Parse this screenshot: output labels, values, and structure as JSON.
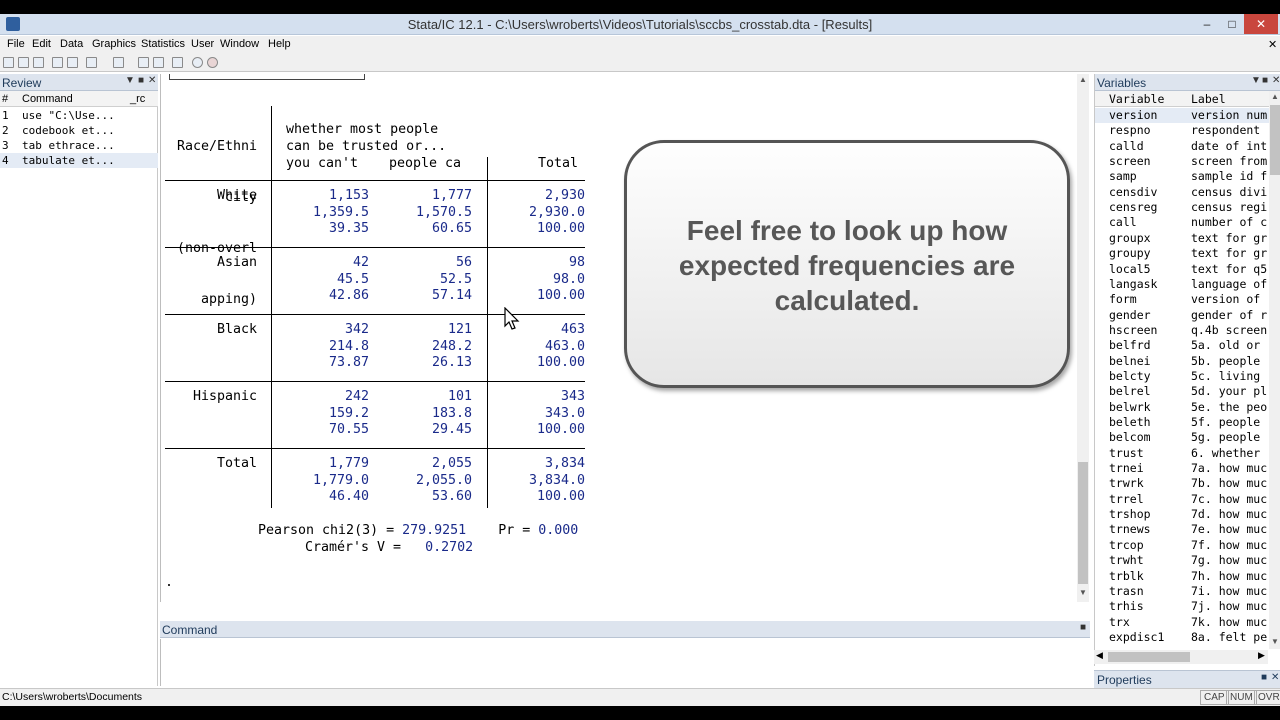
{
  "window": {
    "title": "Stata/IC 12.1 - C:\\Users\\wroberts\\Videos\\Tutorials\\sccbs_crosstab.dta - [Results]"
  },
  "menu": [
    "File",
    "Edit",
    "Data",
    "Graphics",
    "Statistics",
    "User",
    "Window",
    "Help"
  ],
  "review": {
    "title": "Review",
    "columns": [
      "#",
      "Command",
      "_rc"
    ],
    "rows": [
      {
        "n": "1",
        "cmd": "use \"C:\\Use..."
      },
      {
        "n": "2",
        "cmd": "codebook et..."
      },
      {
        "n": "3",
        "cmd": "tab ethrace..."
      },
      {
        "n": "4",
        "cmd": "tabulate et..."
      }
    ]
  },
  "results": {
    "row_header": [
      "Race/Ethni",
      "city",
      "(non-overl",
      "apping)"
    ],
    "col_header": [
      "whether most people",
      "can be trusted or...",
      "you can't",
      "people ca",
      "Total"
    ],
    "rows": [
      {
        "label": "White",
        "c1": [
          "1,153",
          "1,359.5",
          "39.35"
        ],
        "c2": [
          "1,777",
          "1,570.5",
          "60.65"
        ],
        "t": [
          "2,930",
          "2,930.0",
          "100.00"
        ]
      },
      {
        "label": "Asian",
        "c1": [
          "42",
          "45.5",
          "42.86"
        ],
        "c2": [
          "56",
          "52.5",
          "57.14"
        ],
        "t": [
          "98",
          "98.0",
          "100.00"
        ]
      },
      {
        "label": "Black",
        "c1": [
          "342",
          "214.8",
          "73.87"
        ],
        "c2": [
          "121",
          "248.2",
          "26.13"
        ],
        "t": [
          "463",
          "463.0",
          "100.00"
        ]
      },
      {
        "label": "Hispanic",
        "c1": [
          "242",
          "159.2",
          "70.55"
        ],
        "c2": [
          "101",
          "183.8",
          "29.45"
        ],
        "t": [
          "343",
          "343.0",
          "100.00"
        ]
      },
      {
        "label": "Total",
        "c1": [
          "1,779",
          "1,779.0",
          "46.40"
        ],
        "c2": [
          "2,055",
          "2,055.0",
          "53.60"
        ],
        "t": [
          "3,834",
          "3,834.0",
          "100.00"
        ]
      }
    ],
    "stats": {
      "chi_label": "Pearson chi2(3) =",
      "chi_value": "279.9251",
      "pr_label": "Pr =",
      "pr_value": "0.000",
      "cramer_label": "Cramér's V =",
      "cramer_value": "0.2702"
    },
    "prompt": "."
  },
  "callout": {
    "text": "Feel free to look up how expected frequencies are calculated."
  },
  "command": {
    "title": "Command"
  },
  "variables": {
    "title": "Variables",
    "columns": [
      "Variable",
      "Label"
    ],
    "rows": [
      [
        "version",
        "version num"
      ],
      [
        "respno",
        "respondent"
      ],
      [
        "calld",
        "date of int"
      ],
      [
        "screen",
        "screen from"
      ],
      [
        "samp",
        "sample id f"
      ],
      [
        "censdiv",
        "census divi"
      ],
      [
        "censreg",
        "census regi"
      ],
      [
        "call",
        "number of c"
      ],
      [
        "groupx",
        "text for gr"
      ],
      [
        "groupy",
        "text for gr"
      ],
      [
        "local5",
        "text for q5"
      ],
      [
        "langask",
        "language of"
      ],
      [
        "form",
        "version of"
      ],
      [
        "gender",
        "gender of r"
      ],
      [
        "hscreen",
        "q.4b screen"
      ],
      [
        "belfrd",
        "5a. old or"
      ],
      [
        "belnei",
        "5b. people"
      ],
      [
        "belcty",
        "5c. living"
      ],
      [
        "belrel",
        "5d. your pl"
      ],
      [
        "belwrk",
        "5e. the peo"
      ],
      [
        "beleth",
        "5f. people"
      ],
      [
        "belcom",
        "5g. people"
      ],
      [
        "trust",
        "6. whether"
      ],
      [
        "trnei",
        "7a. how muc"
      ],
      [
        "trwrk",
        "7b. how muc"
      ],
      [
        "trrel",
        "7c. how muc"
      ],
      [
        "trshop",
        "7d. how muc"
      ],
      [
        "trnews",
        "7e. how muc"
      ],
      [
        "trcop",
        "7f. how muc"
      ],
      [
        "trwht",
        "7g. how muc"
      ],
      [
        "trblk",
        "7h. how muc"
      ],
      [
        "trasn",
        "7i. how muc"
      ],
      [
        "trhis",
        "7j. how muc"
      ],
      [
        "trx",
        "7k. how muc"
      ],
      [
        "expdisc1",
        "8a. felt pe"
      ]
    ]
  },
  "properties": {
    "title": "Properties"
  },
  "status": {
    "path": "C:\\Users\\wroberts\\Documents",
    "caps": "CAP",
    "num": "NUM",
    "ovr": "OVR"
  }
}
